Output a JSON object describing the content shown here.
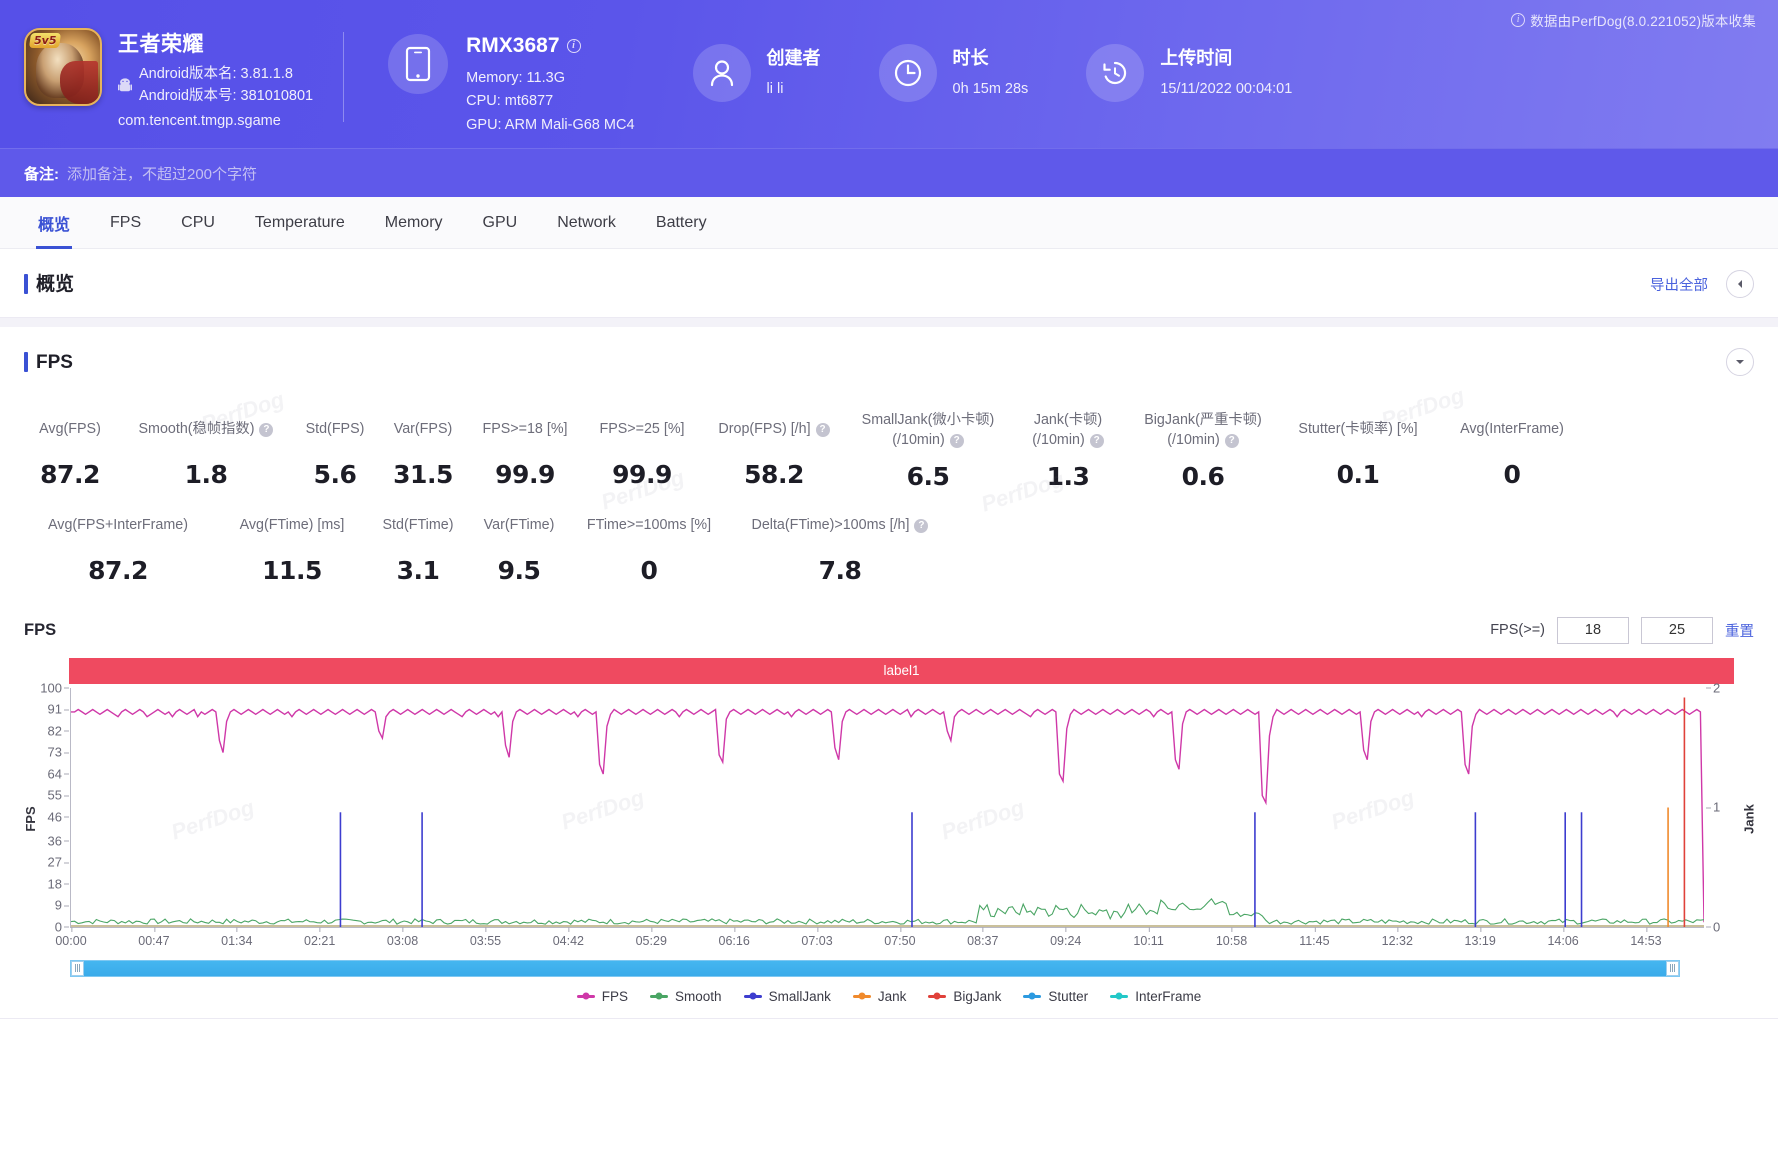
{
  "header": {
    "collect_note": "数据由PerfDog(8.0.221052)版本收集",
    "app": {
      "name": "王者荣耀",
      "version_name": "Android版本名: 3.81.1.8",
      "version_code": "Android版本号: 381010801",
      "package": "com.tencent.tmgp.sgame"
    },
    "device": {
      "model": "RMX3687",
      "memory": "Memory: 11.3G",
      "cpu": "CPU: mt6877",
      "gpu": "GPU: ARM Mali-G68 MC4"
    },
    "creator": {
      "title": "创建者",
      "value": "li li"
    },
    "duration": {
      "title": "时长",
      "value": "0h 15m 28s"
    },
    "upload": {
      "title": "上传时间",
      "value": "15/11/2022 00:04:01"
    },
    "note": {
      "label": "备注:",
      "placeholder": "添加备注，不超过200个字符"
    }
  },
  "tabs": [
    {
      "label": "概览",
      "active": true
    },
    {
      "label": "FPS",
      "active": false
    },
    {
      "label": "CPU",
      "active": false
    },
    {
      "label": "Temperature",
      "active": false
    },
    {
      "label": "Memory",
      "active": false
    },
    {
      "label": "GPU",
      "active": false
    },
    {
      "label": "Network",
      "active": false
    },
    {
      "label": "Battery",
      "active": false
    }
  ],
  "overview": {
    "title": "概览",
    "export_label": "导出全部"
  },
  "fps_panel": {
    "title": "FPS",
    "metrics_row1": [
      {
        "label": "Avg(FPS)",
        "value": "87.2",
        "help": false
      },
      {
        "label": "Smooth(稳帧指数)",
        "value": "1.8",
        "help": true
      },
      {
        "label": "Std(FPS)",
        "value": "5.6",
        "help": false
      },
      {
        "label": "Var(FPS)",
        "value": "31.5",
        "help": false
      },
      {
        "label": "FPS>=18 [%]",
        "value": "99.9",
        "help": false
      },
      {
        "label": "FPS>=25 [%]",
        "value": "99.9",
        "help": false
      },
      {
        "label": "Drop(FPS) [/h]",
        "value": "58.2",
        "help": true
      },
      {
        "label": "SmallJank(微小卡顿)",
        "label2": "(/10min)",
        "value": "6.5",
        "help": true
      },
      {
        "label": "Jank(卡顿)",
        "label2": "(/10min)",
        "value": "1.3",
        "help": true
      },
      {
        "label": "BigJank(严重卡顿)",
        "label2": "(/10min)",
        "value": "0.6",
        "help": true
      },
      {
        "label": "Stutter(卡顿率) [%]",
        "value": "0.1",
        "help": false
      },
      {
        "label": "Avg(InterFrame)",
        "value": "0",
        "help": false
      }
    ],
    "metrics_row2": [
      {
        "label": "Avg(FPS+InterFrame)",
        "value": "87.2",
        "help": false
      },
      {
        "label": "Avg(FTime) [ms]",
        "value": "11.5",
        "help": false
      },
      {
        "label": "Std(FTime)",
        "value": "3.1",
        "help": false
      },
      {
        "label": "Var(FTime)",
        "value": "9.5",
        "help": false
      },
      {
        "label": "FTime>=100ms [%]",
        "value": "0",
        "help": false
      },
      {
        "label": "Delta(FTime)>100ms [/h]",
        "value": "7.8",
        "help": true
      }
    ],
    "chart_header": {
      "name": "FPS",
      "filter_label": "FPS(>=)",
      "threshold_low": "18",
      "threshold_high": "25",
      "reset_label": "重置"
    },
    "label_bar": "label1"
  },
  "chart_data": {
    "type": "line",
    "title": "FPS",
    "xlabel": "",
    "ylabel": "FPS",
    "y2label": "Jank",
    "ylim": [
      0,
      100
    ],
    "y2lim": [
      0,
      2
    ],
    "yticks": [
      0,
      9,
      18,
      27,
      36,
      46,
      55,
      64,
      73,
      82,
      91,
      100
    ],
    "y2ticks": [
      0,
      1,
      2
    ],
    "xticks": [
      "00:00",
      "00:47",
      "01:34",
      "02:21",
      "03:08",
      "03:55",
      "04:42",
      "05:29",
      "06:16",
      "07:03",
      "07:50",
      "08:37",
      "09:24",
      "10:11",
      "10:58",
      "11:45",
      "12:32",
      "13:19",
      "14:06",
      "14:53"
    ],
    "grid": false,
    "legend_position": "bottom",
    "annotation_band": "label1",
    "series": [
      {
        "name": "FPS",
        "color": "#cf38a8",
        "axis": "left",
        "mean": 89,
        "values": [
          90,
          90,
          91,
          90,
          89,
          90,
          91,
          90,
          89,
          90,
          91,
          90,
          89,
          88,
          90,
          91,
          90,
          89,
          90,
          91,
          90,
          88,
          89,
          90,
          91,
          90,
          89,
          90,
          88,
          90,
          91,
          90,
          89,
          90,
          91,
          88,
          90,
          89,
          90,
          91,
          90,
          78,
          73,
          86,
          90,
          91,
          90,
          89,
          90,
          91,
          90,
          89,
          90,
          91,
          90,
          89,
          90,
          91,
          90,
          89,
          90,
          88,
          90,
          91,
          90,
          89,
          90,
          91,
          90,
          89,
          90,
          91,
          90,
          89,
          90,
          91,
          90,
          89,
          90,
          91,
          90,
          89,
          90,
          91,
          90,
          82,
          79,
          88,
          90,
          91,
          90,
          89,
          90,
          91,
          90,
          89,
          90,
          91,
          90,
          89,
          90,
          91,
          90,
          89,
          90,
          91,
          90,
          89,
          88,
          90,
          91,
          90,
          89,
          90,
          91,
          90,
          89,
          90,
          88,
          90,
          76,
          71,
          86,
          90,
          91,
          90,
          89,
          90,
          91,
          90,
          89,
          90,
          91,
          90,
          89,
          90,
          91,
          90,
          89,
          90,
          88,
          90,
          91,
          90,
          89,
          90,
          68,
          64,
          84,
          89,
          91,
          90,
          89,
          90,
          91,
          90,
          89,
          90,
          91,
          90,
          89,
          90,
          91,
          90,
          89,
          90,
          91,
          90,
          88,
          90,
          91,
          90,
          89,
          90,
          91,
          90,
          89,
          90,
          91,
          72,
          69,
          87,
          90,
          91,
          90,
          89,
          90,
          91,
          90,
          89,
          90,
          91,
          90,
          89,
          90,
          91,
          90,
          89,
          90,
          88,
          90,
          91,
          90,
          89,
          90,
          91,
          90,
          89,
          90,
          91,
          90,
          75,
          70,
          86,
          90,
          91,
          90,
          89,
          90,
          91,
          90,
          89,
          90,
          91,
          90,
          89,
          90,
          91,
          90,
          89,
          90,
          91,
          88,
          90,
          91,
          90,
          89,
          90,
          91,
          90,
          89,
          90,
          82,
          78,
          88,
          90,
          91,
          90,
          89,
          90,
          91,
          90,
          89,
          90,
          91,
          90,
          89,
          90,
          91,
          90,
          89,
          90,
          91,
          90,
          89,
          88,
          90,
          91,
          90,
          89,
          90,
          91,
          90,
          64,
          61,
          83,
          89,
          91,
          90,
          89,
          90,
          91,
          90,
          89,
          90,
          91,
          90,
          89,
          90,
          91,
          90,
          89,
          90,
          91,
          90,
          89,
          90,
          91,
          90,
          88,
          90,
          91,
          90,
          89,
          90,
          70,
          66,
          85,
          90,
          91,
          90,
          89,
          90,
          91,
          90,
          89,
          90,
          91,
          90,
          89,
          90,
          91,
          90,
          89,
          90,
          91,
          90,
          89,
          90,
          55,
          52,
          80,
          88,
          91,
          90,
          89,
          90,
          91,
          90,
          89,
          90,
          91,
          90,
          89,
          90,
          91,
          90,
          89,
          90,
          91,
          90,
          89,
          90,
          91,
          90,
          89,
          90,
          74,
          70,
          86,
          90,
          91,
          90,
          89,
          90,
          91,
          90,
          89,
          90,
          91,
          90,
          89,
          90,
          88,
          90,
          91,
          90,
          89,
          90,
          91,
          90,
          89,
          90,
          91,
          90,
          68,
          64,
          84,
          89,
          91,
          90,
          89,
          90,
          91,
          90,
          89,
          90,
          91,
          90,
          89,
          90,
          91,
          90,
          89,
          90,
          91,
          90,
          89,
          90,
          91,
          90,
          89,
          90,
          91,
          90,
          89,
          90,
          91,
          90,
          89,
          90,
          91,
          90,
          89,
          90,
          91,
          90,
          88,
          90,
          91,
          90,
          89,
          90,
          91,
          90,
          89,
          90,
          91,
          90,
          89,
          90,
          91,
          90,
          89,
          90,
          91,
          90,
          89,
          90,
          91,
          90,
          2
        ]
      },
      {
        "name": "Smooth",
        "color": "#4aa564",
        "axis": "left",
        "mean": 2
      },
      {
        "name": "SmallJank",
        "color": "#3d3dcf",
        "axis": "right",
        "spikes_at": [
          "01:45",
          "02:24",
          "07:50",
          "10:58",
          "13:15",
          "14:02",
          "14:10"
        ]
      },
      {
        "name": "Jank",
        "color": "#f08a2c",
        "axis": "right",
        "spikes_at": [
          "14:50"
        ]
      },
      {
        "name": "BigJank",
        "color": "#e0413a",
        "axis": "right",
        "spikes_at": [
          "15:05"
        ]
      },
      {
        "name": "Stutter",
        "color": "#2c9ae0",
        "axis": "right",
        "spikes_at": []
      },
      {
        "name": "InterFrame",
        "color": "#23c8c8",
        "axis": "left",
        "spikes_at": []
      }
    ],
    "legend": [
      {
        "name": "FPS",
        "color": "#cf38a8"
      },
      {
        "name": "Smooth",
        "color": "#4aa564"
      },
      {
        "name": "SmallJank",
        "color": "#3d3dcf"
      },
      {
        "name": "Jank",
        "color": "#f08a2c"
      },
      {
        "name": "BigJank",
        "color": "#e0413a"
      },
      {
        "name": "Stutter",
        "color": "#2c9ae0"
      },
      {
        "name": "InterFrame",
        "color": "#23c8c8"
      }
    ]
  },
  "watermark": "PerfDog"
}
